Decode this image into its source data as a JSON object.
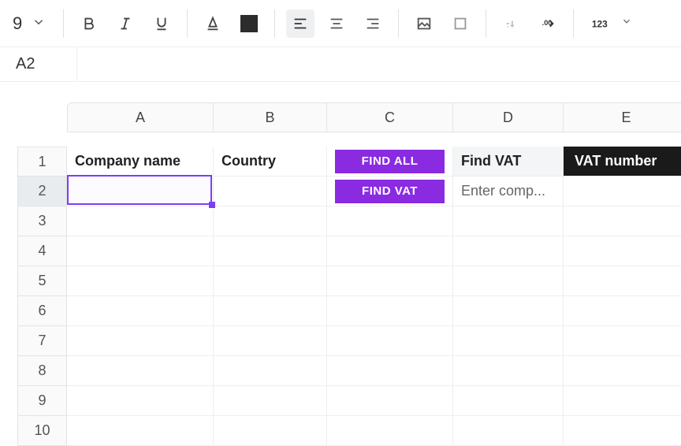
{
  "toolbar": {
    "font_size": "9"
  },
  "name_box": "A2",
  "columns": [
    "A",
    "B",
    "C",
    "D",
    "E"
  ],
  "rows": [
    "1",
    "2",
    "3",
    "4",
    "5",
    "6",
    "7",
    "8",
    "9",
    "10"
  ],
  "selected_row_index": 1,
  "header_row": {
    "company_name": "Company name",
    "country": "Country",
    "find_all_btn": "FIND ALL",
    "find_vat_header": "Find VAT",
    "vat_number": "VAT number"
  },
  "row2": {
    "find_vat_btn": "FIND VAT",
    "enter_company": "Enter comp..."
  },
  "colors": {
    "accent": "#8a2be2",
    "selection": "#7b3ff2",
    "black_cell": "#1a1a1a"
  }
}
